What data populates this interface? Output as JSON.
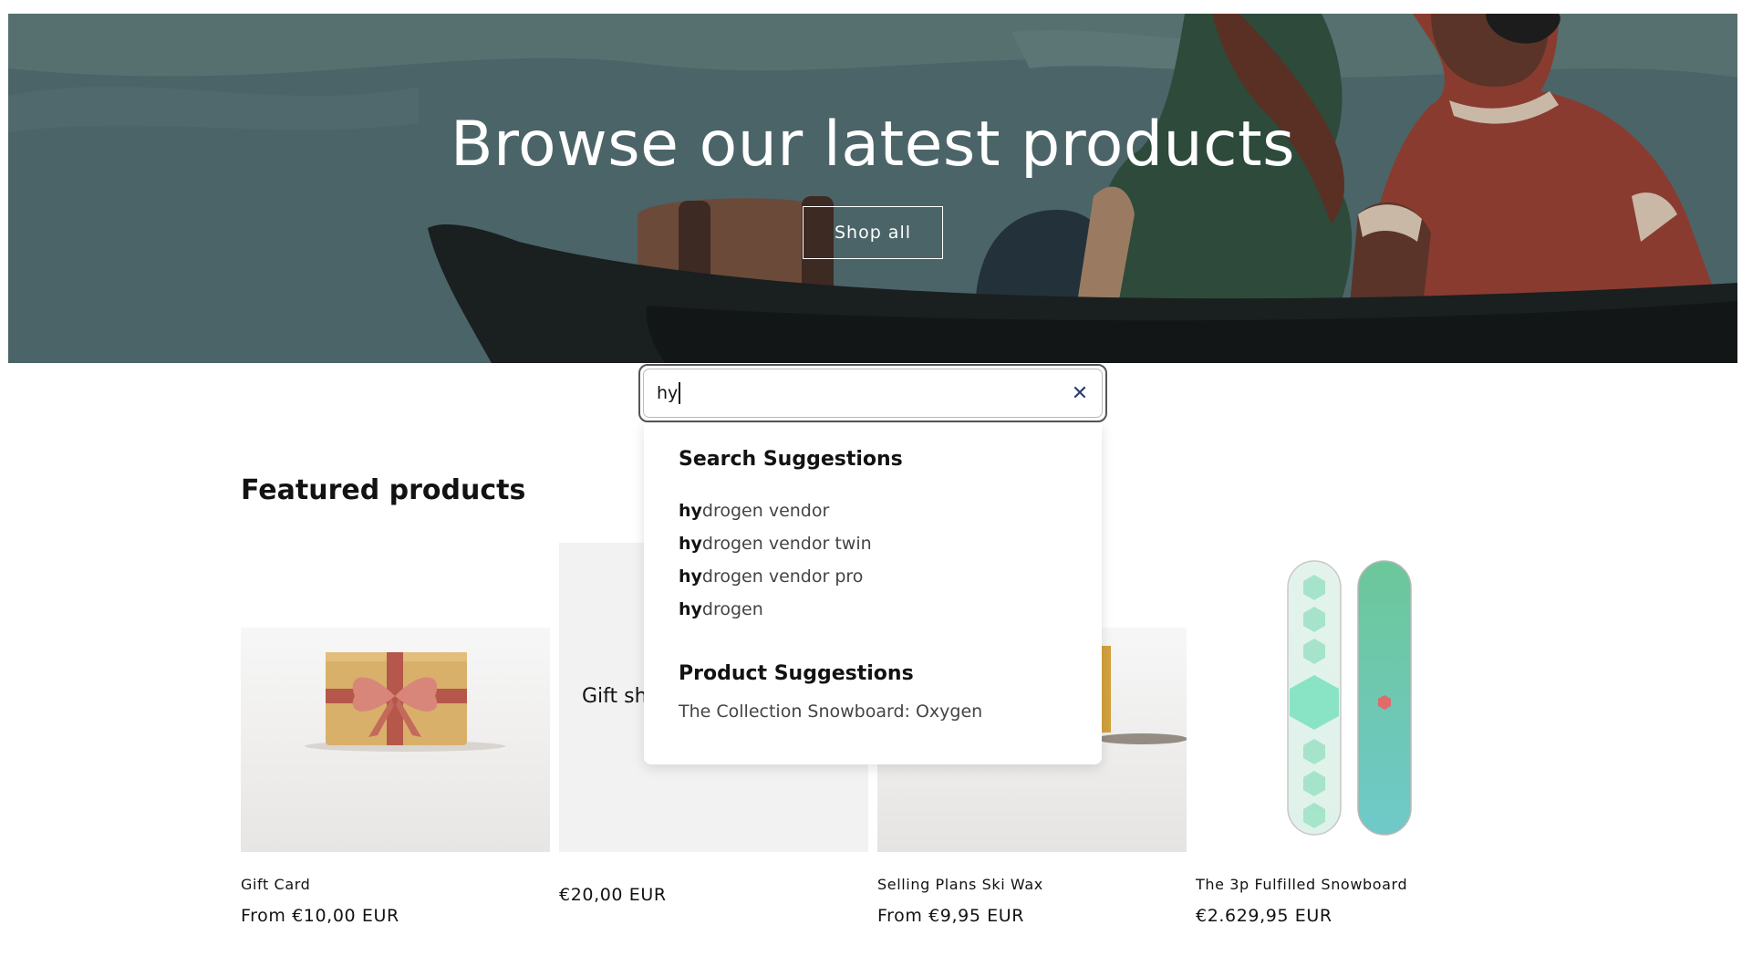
{
  "hero": {
    "title": "Browse our latest products",
    "button_label": "Shop all"
  },
  "search": {
    "value": "hy",
    "clear_icon": "close-icon"
  },
  "suggestions": {
    "heading": "Search Suggestions",
    "items": [
      {
        "match": "hy",
        "rest": "drogen vendor"
      },
      {
        "match": "hy",
        "rest": "drogen vendor twin"
      },
      {
        "match": "hy",
        "rest": "drogen vendor pro"
      },
      {
        "match": "hy",
        "rest": "drogen"
      }
    ],
    "product_heading": "Product Suggestions",
    "products": [
      "The Collection Snowboard: Oxygen"
    ]
  },
  "featured": {
    "title": "Featured products",
    "products": [
      {
        "name": "Gift Card",
        "price": "From €10,00 EUR"
      },
      {
        "name": "",
        "image_text": "Gift sh",
        "price": "€20,00 EUR"
      },
      {
        "name": "Selling Plans Ski Wax",
        "price": "From €9,95 EUR"
      },
      {
        "name": "The 3p Fulfilled Snowboard",
        "price": "€2.629,95 EUR"
      }
    ]
  },
  "colors": {
    "hero_bg": "#4a6368",
    "clear_icon": "#2d3d6b"
  }
}
